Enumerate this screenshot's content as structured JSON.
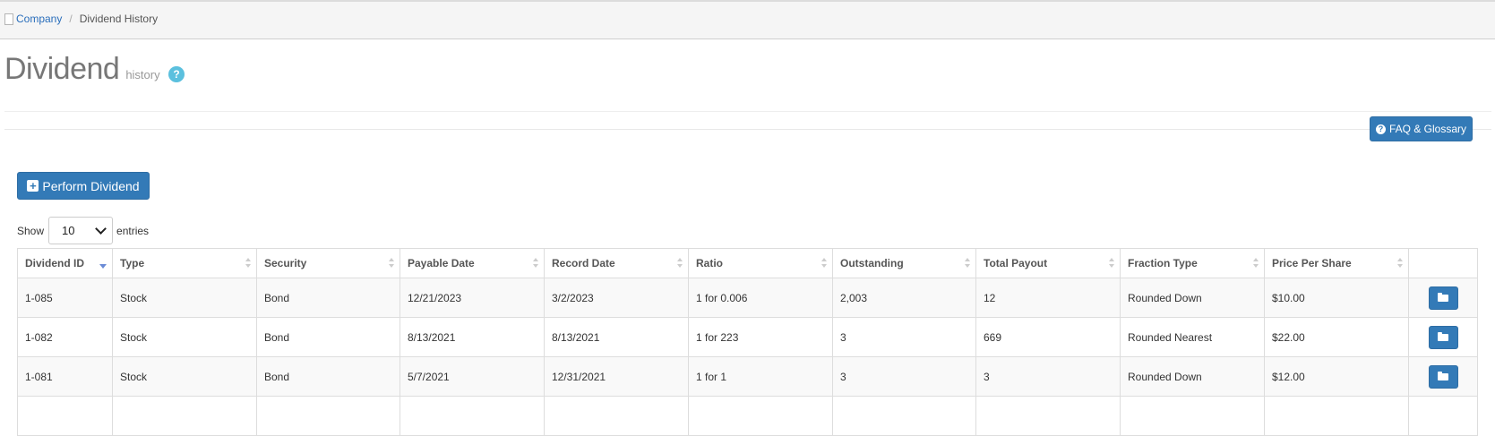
{
  "breadcrumb": {
    "root": "Company",
    "current": "Dividend History"
  },
  "page": {
    "title": "Dividend",
    "subtitle": "history",
    "help_glyph": "?"
  },
  "toolbar": {
    "faq_label": "FAQ & Glossary",
    "perform_label": "Perform Dividend"
  },
  "length_menu": {
    "show_label": "Show",
    "selected": "10",
    "entries_label": "entries"
  },
  "table": {
    "columns": [
      "Dividend ID",
      "Type",
      "Security",
      "Payable Date",
      "Record Date",
      "Ratio",
      "Outstanding",
      "Total Payout",
      "Fraction Type",
      "Price Per Share",
      ""
    ],
    "sorted_column": "Dividend ID",
    "sort_direction": "descending",
    "rows": [
      [
        "1-085",
        "Stock",
        "Bond",
        "12/21/2023",
        "3/2/2023",
        "1 for 0.006",
        "2,003",
        "12",
        "Rounded Down",
        "$10.00"
      ],
      [
        "1-082",
        "Stock",
        "Bond",
        "8/13/2021",
        "8/13/2021",
        "1 for 223",
        "3",
        "669",
        "Rounded Nearest",
        "$22.00"
      ],
      [
        "1-081",
        "Stock",
        "Bond",
        "5/7/2021",
        "12/31/2021",
        "1 for 1",
        "3",
        "3",
        "Rounded Down",
        "$12.00"
      ]
    ],
    "row_action_icon": "folder-open-icon"
  },
  "colors": {
    "primary": "#337ab7",
    "link": "#2a6ebb",
    "help": "#5bc0de",
    "sort_active": "#6b8bd6"
  }
}
